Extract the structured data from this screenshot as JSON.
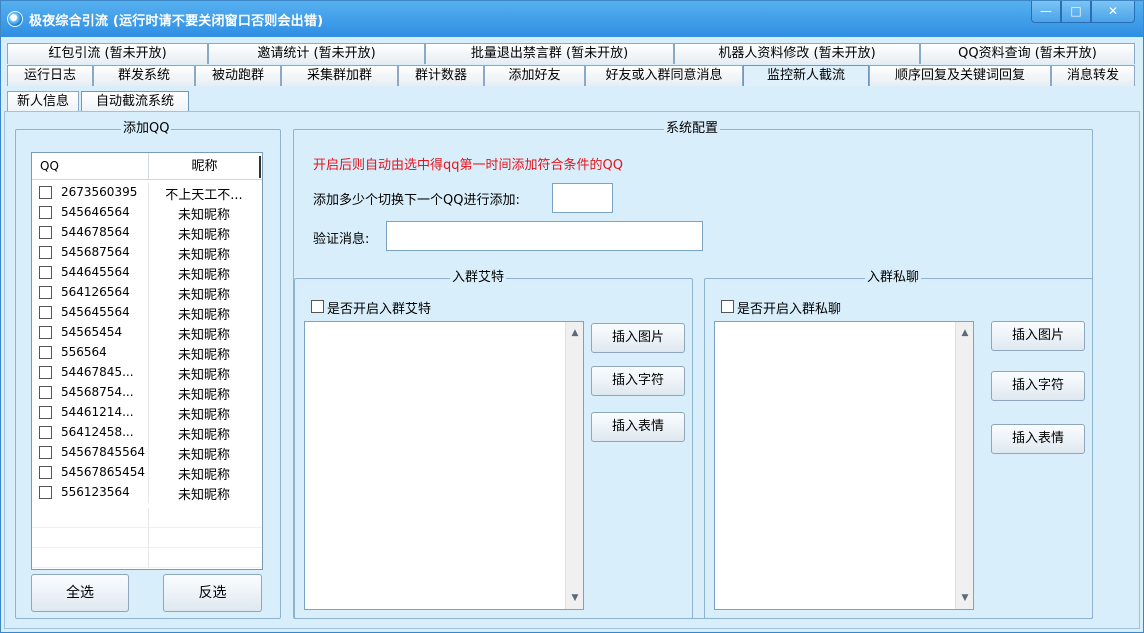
{
  "window": {
    "title": "极夜综合引流 (运行时请不要关闭窗口否则会出错)"
  },
  "tabs_row1": [
    "红包引流 (暂未开放)",
    "邀请统计 (暂未开放)",
    "批量退出禁言群 (暂未开放)",
    "机器人资料修改 (暂未开放)",
    "QQ资料查询 (暂未开放)"
  ],
  "tabs_row2": [
    "运行日志",
    "群发系统",
    "被动跑群",
    "采集群加群",
    "群计数器",
    "添加好友",
    "好友或入群同意消息",
    "监控新人截流",
    "顺序回复及关键词回复",
    "消息转发"
  ],
  "tabs_row3": [
    "新人信息",
    "自动截流系统"
  ],
  "add_qq": {
    "title": "添加QQ",
    "col_qq": "QQ",
    "col_nick": "昵称",
    "rows": [
      {
        "qq": "2673560395",
        "nick": "不上天工不..."
      },
      {
        "qq": "545646564",
        "nick": "未知昵称"
      },
      {
        "qq": "544678564",
        "nick": "未知昵称"
      },
      {
        "qq": "545687564",
        "nick": "未知昵称"
      },
      {
        "qq": "544645564",
        "nick": "未知昵称"
      },
      {
        "qq": "564126564",
        "nick": "未知昵称"
      },
      {
        "qq": "545645564",
        "nick": "未知昵称"
      },
      {
        "qq": "54565454",
        "nick": "未知昵称"
      },
      {
        "qq": "556564",
        "nick": "未知昵称"
      },
      {
        "qq": "54467845...",
        "nick": "未知昵称"
      },
      {
        "qq": "54568754...",
        "nick": "未知昵称"
      },
      {
        "qq": "54461214...",
        "nick": "未知昵称"
      },
      {
        "qq": "56412458...",
        "nick": "未知昵称"
      },
      {
        "qq": "54567845564",
        "nick": "未知昵称"
      },
      {
        "qq": "54567865454",
        "nick": "未知昵称"
      },
      {
        "qq": "556123564",
        "nick": "未知昵称"
      }
    ],
    "select_all": "全选",
    "invert": "反选"
  },
  "config": {
    "title": "系统配置",
    "notice": "开启后则自动由选中得qq第一时间添加符合条件的QQ",
    "switch_label": "添加多少个切换下一个QQ进行添加:",
    "switch_value": "",
    "verify_label": "验证消息:",
    "verify_value": ""
  },
  "at_group": {
    "title": "入群艾特",
    "enable_label": "是否开启入群艾特",
    "insert_image": "插入图片",
    "insert_char": "插入字符",
    "insert_emoji": "插入表情"
  },
  "private_group": {
    "title": "入群私聊",
    "enable_label": "是否开启入群私聊",
    "insert_image": "插入图片",
    "insert_char": "插入字符",
    "insert_emoji": "插入表情"
  }
}
